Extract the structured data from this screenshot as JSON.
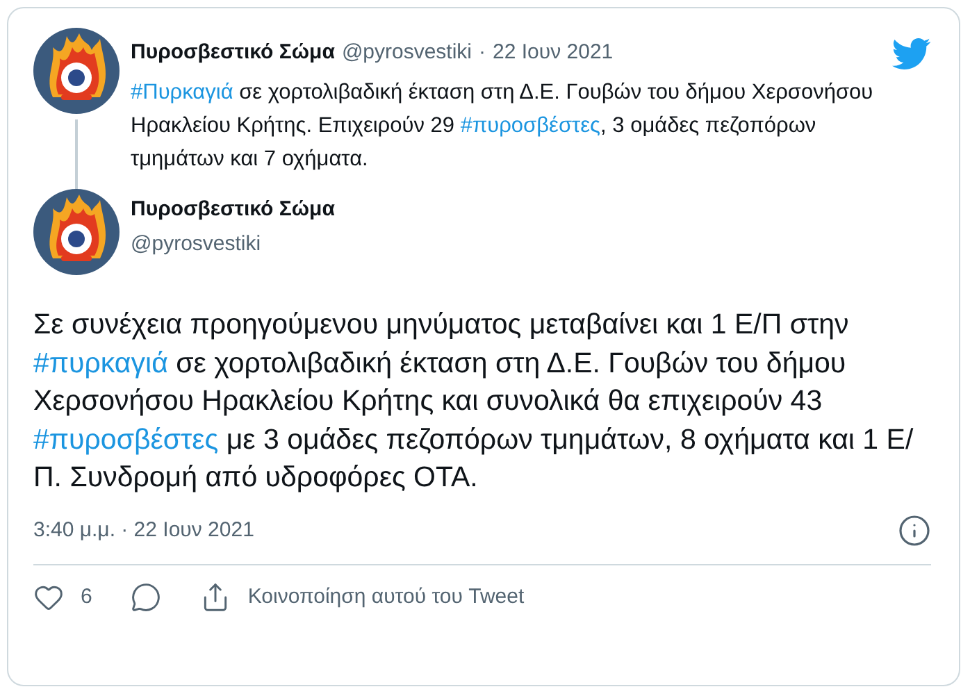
{
  "quoted_tweet": {
    "author": "Πυροσβεστικό Σώμα",
    "handle": "@pyrosvestiki",
    "separator": "·",
    "date": "22 Ιουν 2021",
    "text": [
      {
        "kind": "hashtag",
        "text": "#Πυρκαγιά"
      },
      {
        "kind": "text",
        "text": " σε χορτολιβαδική έκταση στη Δ.Ε. Γουβών του δήμου Χερσονήσου Ηρακλείου Κρήτης. Επιχειρούν 29 "
      },
      {
        "kind": "hashtag",
        "text": "#πυροσβέστες"
      },
      {
        "kind": "text",
        "text": ", 3 ομάδες πεζοπόρων τμημάτων και 7 οχήματα."
      }
    ]
  },
  "tweet": {
    "author": "Πυροσβεστικό Σώμα",
    "handle": "@pyrosvestiki",
    "text": [
      {
        "kind": "text",
        "text": "Σε συνέχεια προηγούμενου μηνύματος μεταβαίνει και 1 Ε/Π στην "
      },
      {
        "kind": "hashtag",
        "text": "#πυρκαγιά"
      },
      {
        "kind": "text",
        "text": " σε χορτολιβαδική έκταση στη Δ.Ε. Γουβών του δήμου Χερσονήσου Ηρακλείου Κρήτης και συνολικά θα επιχειρούν 43 "
      },
      {
        "kind": "hashtag",
        "text": "#πυροσβέστες"
      },
      {
        "kind": "text",
        "text": " με 3 ομάδες πεζοπόρων τμημάτων, 8 οχήματα και 1 Ε/Π. Συνδρομή από υδροφόρες ΟΤΑ."
      }
    ],
    "timestamp": "3:40 μ.μ. · 22 Ιουν 2021",
    "like_count": "6",
    "share_label": "Κοινοποίηση αυτού του Tweet"
  }
}
